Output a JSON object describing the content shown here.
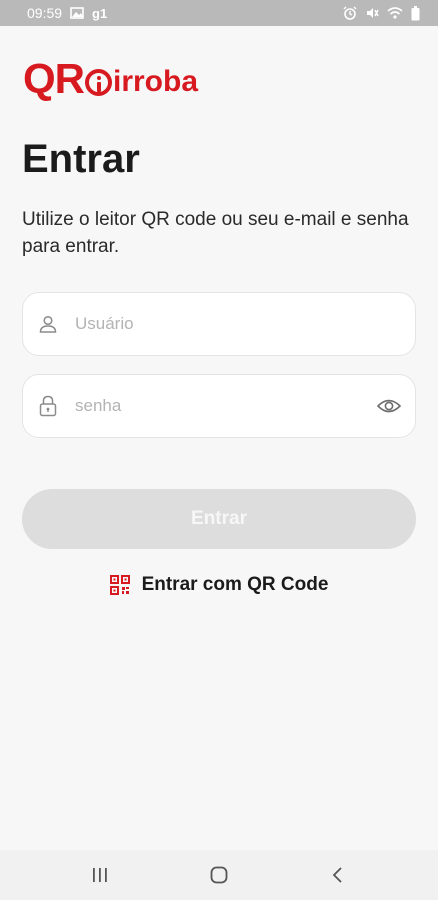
{
  "status_bar": {
    "time": "09:59",
    "carrier": "g1",
    "icons": [
      "image-icon",
      "alarm-icon",
      "mute-icon",
      "wifi-icon",
      "battery-icon"
    ]
  },
  "logo": {
    "qr": "QR",
    "text": "irroba"
  },
  "login": {
    "title": "Entrar",
    "subtitle": "Utilize o leitor QR code ou seu e-mail e senha para entrar.",
    "username_placeholder": "Usuário",
    "password_placeholder": "senha",
    "submit_label": "Entrar",
    "qr_link_label": "Entrar com QR Code"
  },
  "nav": {
    "icons": [
      "recent-apps-icon",
      "home-icon",
      "back-icon"
    ]
  },
  "colors": {
    "brand": "#d71920",
    "button_disabled": "#dddddd",
    "background": "#f7f7f7"
  }
}
